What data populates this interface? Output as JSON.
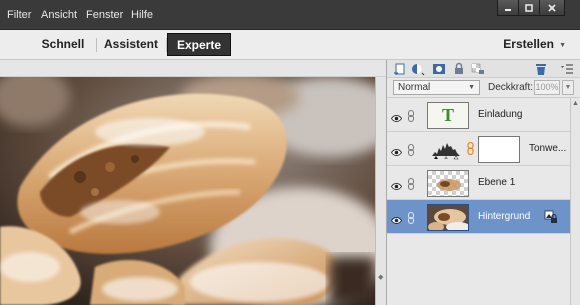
{
  "menubar": {
    "items": [
      "Filter",
      "Ansicht",
      "Fenster",
      "Hilfe"
    ],
    "window_controls": [
      "minimize-icon",
      "restore-icon",
      "close-icon"
    ]
  },
  "modebar": {
    "modes": [
      "Schnell",
      "Assistent",
      "Experte"
    ],
    "active_mode": "Experte",
    "create_label": "Erstellen"
  },
  "layers_panel": {
    "toolbar_icons": [
      "new-layer-icon",
      "adjustment-layer-icon",
      "layer-mask-icon",
      "lock-all-icon",
      "lock-transparency-icon",
      "delete-layer-icon",
      "panel-menu-icon"
    ],
    "blend_mode": "Normal",
    "opacity_label": "Deckkraft:",
    "opacity_value": "100%",
    "layers": [
      {
        "name": "Einladung",
        "type": "text",
        "thumb_letter": "T"
      },
      {
        "name": "Tonwe...",
        "type": "levels-adjustment"
      },
      {
        "name": "Ebene 1",
        "type": "transparent"
      },
      {
        "name": "Hintergrund",
        "type": "photo",
        "selected": true
      }
    ]
  },
  "colors": {
    "menubar_bg": "#3a3a3a",
    "modebar_bg": "#ededed",
    "active_mode_bg": "#333333",
    "panel_bg": "#e8e8e8",
    "selected_layer_bg": "#6e93c9",
    "text_thumb_green": "#3b8a2e",
    "link_orange": "#e08a1e"
  }
}
